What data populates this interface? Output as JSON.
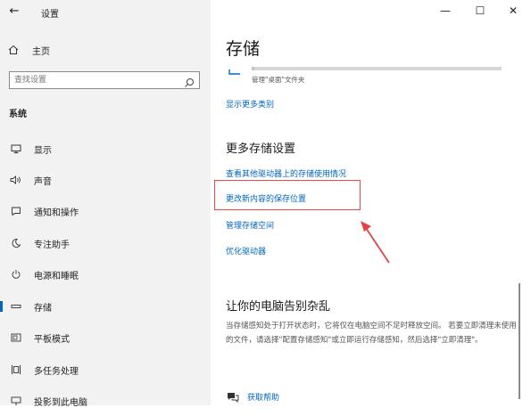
{
  "window": {
    "title": "设置",
    "back_icon": "←",
    "minimize_icon": "—",
    "maximize_icon": "☐",
    "close_icon": "✕"
  },
  "sidebar": {
    "home_label": "主页",
    "search_placeholder": "查找设置",
    "section_title": "系统",
    "items": [
      {
        "label": "显示",
        "icon": "monitor-icon"
      },
      {
        "label": "声音",
        "icon": "speaker-icon"
      },
      {
        "label": "通知和操作",
        "icon": "notification-icon"
      },
      {
        "label": "专注助手",
        "icon": "moon-icon"
      },
      {
        "label": "电源和睡眠",
        "icon": "power-icon"
      },
      {
        "label": "存储",
        "icon": "storage-icon",
        "active": true
      },
      {
        "label": "平板模式",
        "icon": "tablet-icon"
      },
      {
        "label": "多任务处理",
        "icon": "multitask-icon"
      },
      {
        "label": "投影到此电脑",
        "icon": "project-icon"
      }
    ]
  },
  "main": {
    "page_title": "存储",
    "storage_bar": {
      "label": "管理\"桌面\"文件夹",
      "fill_fraction": 0.01
    },
    "show_more_link": "显示更多类别",
    "more_settings_heading": "更多存储设置",
    "links": [
      "查看其他驱动器上的存储使用情况",
      "更改新内容的保存位置",
      "管理存储空间",
      "优化驱动器"
    ],
    "highlighted_link_index": 1,
    "declutter_heading": "让你的电脑告别杂乱",
    "declutter_text": "当存储感知处于打开状态时，它将仅在电脑空间不足时释放空间。 若要立即清理未使用的文件，请选择\"配置存储感知\"或立即运行存储感知，然后选择\"立即清理\"。",
    "help_link": "获取帮助"
  },
  "colors": {
    "accent": "#0067c0",
    "sidebar_bg": "#f2f2f2",
    "annotation_red": "#e44444"
  }
}
